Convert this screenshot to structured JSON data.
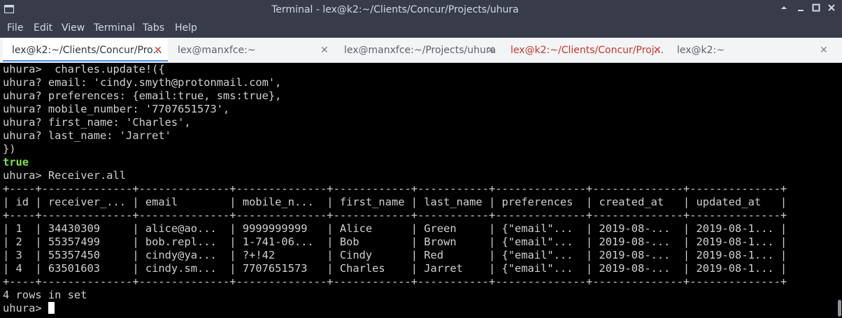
{
  "window": {
    "title": "Terminal - lex@k2:~/Clients/Concur/Projects/uhura",
    "icon": "terminal-icon",
    "controls": [
      "minimize-up-icon",
      "minimize-icon",
      "maximize-icon",
      "close-icon"
    ]
  },
  "menu": [
    "File",
    "Edit",
    "View",
    "Terminal",
    "Tabs",
    "Help"
  ],
  "tabs": [
    {
      "label": "lex@k2:~/Clients/Concur/Pro...",
      "close": "✕"
    },
    {
      "label": "lex@manxfce:~",
      "close": "✕"
    },
    {
      "label": "lex@manxfce:~/Projects/uhura",
      "close": "✕"
    },
    {
      "label": "lex@k2:~/Clients/Concur/Proj...",
      "close": "✕"
    },
    {
      "label": "lex@k2:~",
      "close": "✕"
    }
  ],
  "terminal": {
    "lines": [
      "uhura>  charles.update!({",
      "uhura? email: 'cindy.smyth@protonmail.com',",
      "uhura? preferences: {email:true, sms:true},",
      "uhura? mobile_number: '7707651573',",
      "uhura? first_name: 'Charles',",
      "uhura? last_name: 'Jarret'",
      "})",
      "true",
      "uhura> Receiver.all",
      "+----+--------------+--------------+--------------+------------+-----------+--------------+--------------+--------------+",
      "| id | receiver_... | email        | mobile_n...  | first_name | last_name | preferences  | created_at   | updated_at   |",
      "+----+--------------+--------------+--------------+------------+-----------+--------------+--------------+--------------+",
      "| 1  | 34430309     | alice@ao...  | 9999999999   | Alice      | Green     | {\"email\"...  | 2019-08-...  | 2019-08-1... |",
      "| 2  | 55357499     | bob.repl...  | 1-741-06...  | Bob        | Brown     | {\"email\"...  | 2019-08-...  | 2019-08-1... |",
      "| 3  | 55357450     | cindy@ya...  | ?+!42        | Cindy      | Red       | {\"email\"...  | 2019-08-...  | 2019-08-1... |",
      "| 4  | 63501603     | cindy.sm...  | 7707651573   | Charles    | Jarret    | {\"email\"...  | 2019-08-...  | 2019-08-1... |",
      "+----+--------------+--------------+--------------+------------+-----------+--------------+--------------+--------------+",
      "4 rows in set",
      "uhura> "
    ]
  }
}
